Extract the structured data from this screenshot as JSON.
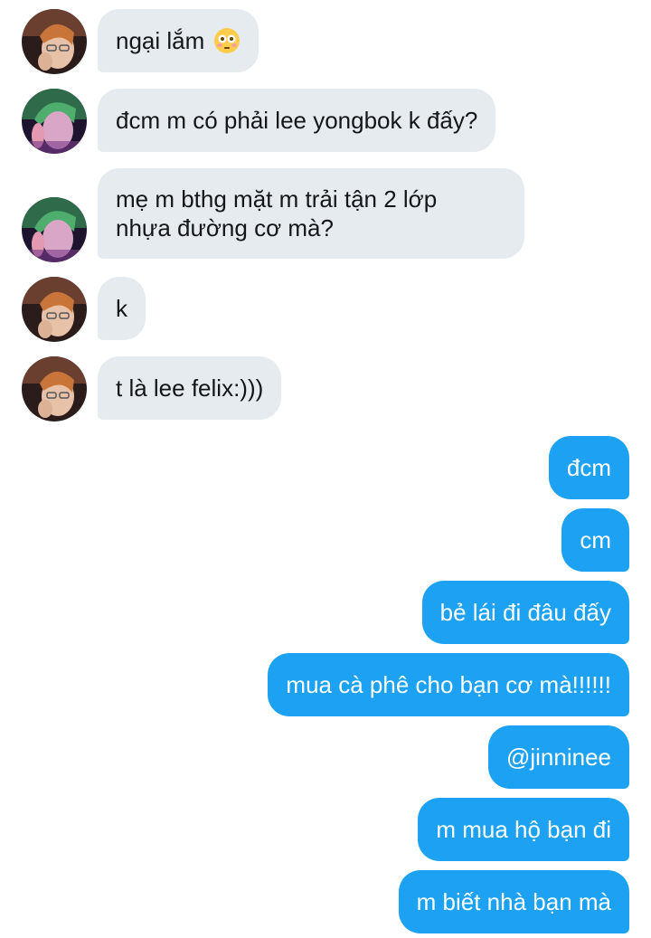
{
  "conversation": {
    "received": [
      {
        "avatar": "avatar-orange",
        "lines": [
          "ngại lắm"
        ],
        "emoji": "flushed-face-icon"
      },
      {
        "avatar": "avatar-green",
        "lines": [
          "đcm m có phải lee yongbok k đấy?"
        ]
      },
      {
        "avatar": "avatar-green",
        "lines": [
          "mẹ m bthg mặt m trải tận 2 lớp",
          "nhựa đường cơ mà?"
        ]
      },
      {
        "avatar": "avatar-orange",
        "lines": [
          "k"
        ]
      },
      {
        "avatar": "avatar-orange",
        "lines": [
          "t là lee felix:)))"
        ]
      }
    ],
    "sent": [
      "đcm",
      "cm",
      "bẻ lái đi đâu đấy",
      "mua cà phê cho bạn cơ mà!!!!!!",
      "@jinninee",
      "m mua hộ bạn đi",
      "m biết nhà bạn mà"
    ]
  },
  "colors": {
    "received_bubble": "#e6ebef",
    "sent_bubble": "#1da1f2",
    "received_text": "#14171a",
    "sent_text": "#ffffff"
  }
}
